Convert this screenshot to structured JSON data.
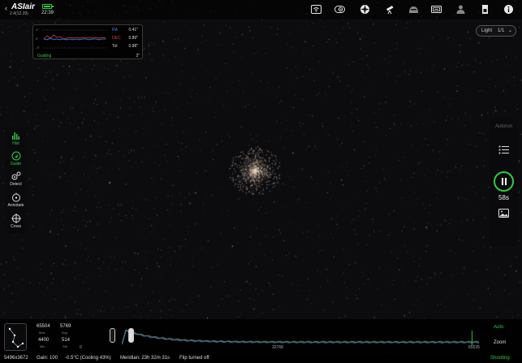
{
  "app": {
    "logo": "ASIair",
    "version": "2.4(12.29)",
    "back_label": "‹",
    "time": "22:39",
    "battery_color": "#2ecc40"
  },
  "top_icons": [
    "wifi-icon",
    "camera-icon",
    "aperture-icon",
    "telescope-mount-icon",
    "guide-scope-icon",
    "filter-wheel-icon",
    "focuser-icon",
    "storage-icon",
    "info-icon"
  ],
  "guide_graph": {
    "axis_top": "4\"",
    "axis_mid": "0\"",
    "axis_bottom": "-4\"",
    "ra_label": "RA",
    "ra_value": "0.41\"",
    "ra_color": "#3b82f6",
    "dec_label": "DEC",
    "dec_value": "0.89\"",
    "dec_color": "#e03b3b",
    "tot_label": "Tot",
    "tot_value": "0.98\"",
    "state": "Guiding",
    "exposure": "2\""
  },
  "frame_selector": {
    "type": "Light",
    "count": "1/1",
    "chevron": "⌄"
  },
  "tools": {
    "hist": "Hist",
    "guide": "Guide",
    "detect": "Detect",
    "annotate": "Annotate",
    "cross": "Cross"
  },
  "right_panel": {
    "autorun": "Autorun",
    "exposure_remaining": "58s"
  },
  "histogram": {
    "max_value": "65504",
    "max_label": "Max",
    "avg_value": "5769",
    "avg_label": "Avg",
    "min_value": "4400",
    "min_label": "Min",
    "std_value": "514",
    "std_label": "Std",
    "tick_start": "0",
    "tick_mid": "32768",
    "tick_end": "65535",
    "auto_label": "Auto",
    "zoom_label": "Zoom"
  },
  "status_bar": {
    "resolution": "5496x3672",
    "gain": "Gain: 100",
    "temperature": "-0.5°C (Cooling 43%)",
    "meridian": "Meridian: 23h 32m 31s",
    "flip": "Flip turned off",
    "state": "Shooting"
  }
}
